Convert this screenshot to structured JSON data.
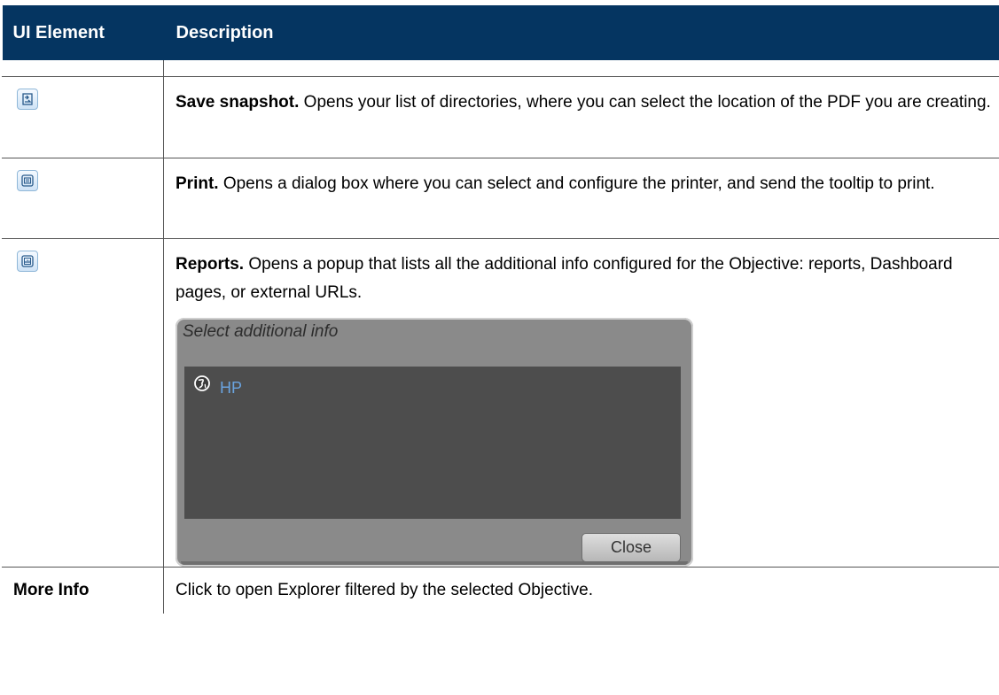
{
  "table": {
    "col1_header": "UI Element",
    "col2_header": "Description"
  },
  "rows": [
    {
      "icon": "save-snapshot-icon",
      "title": "Save snapshot.",
      "text": " Opens your list of directories, where you can select the location of the PDF you are creating."
    },
    {
      "icon": "print-icon",
      "title": "Print.",
      "text": " Opens a dialog box where you can select and configure the printer, and send the tooltip to print."
    },
    {
      "icon": "reports-icon",
      "title": "Reports.",
      "text": " Opens a popup that lists all the additional info configured for the Objective: reports, Dashboard pages, or external URLs."
    },
    {
      "label": "More Info",
      "text": "Click to open Explorer filtered by the selected Objective."
    }
  ],
  "popup": {
    "title": "Select additional info",
    "items": [
      {
        "icon": "globe-icon",
        "label": "HP"
      }
    ],
    "close_label": "Close"
  },
  "colors": {
    "header_bg": "#053561",
    "link": "#6aa4e0"
  }
}
